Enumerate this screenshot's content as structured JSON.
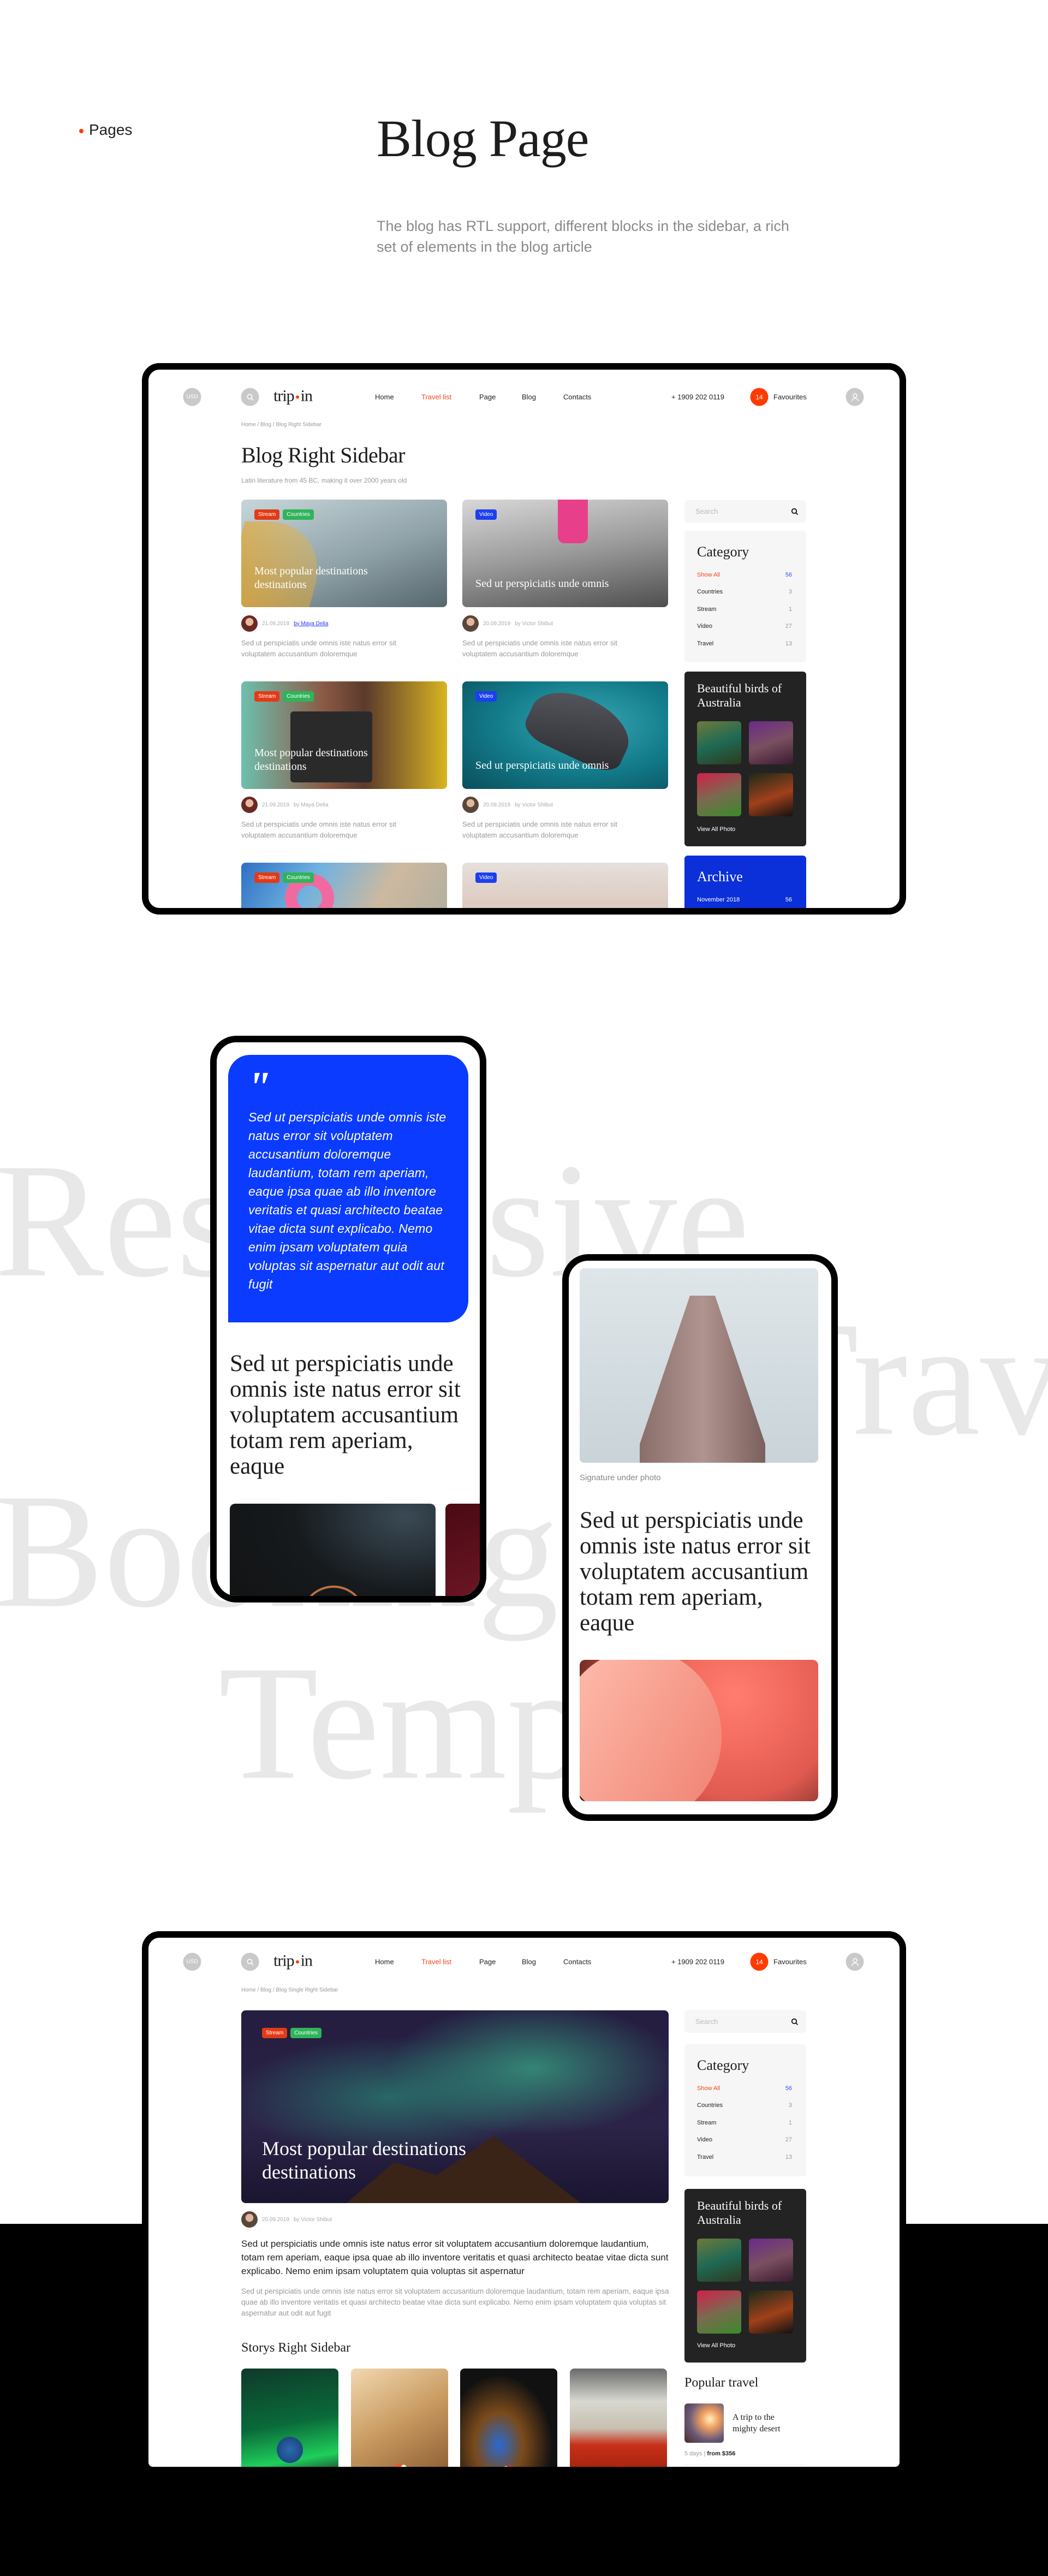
{
  "intro": {
    "section_label": "Pages",
    "title": "Blog Page",
    "subtitle": "The blog has RTL support, different blocks in the sidebar, a rich set of elements in the blog article"
  },
  "background_words": [
    "Responsive",
    "Travel",
    "Booking",
    "Template"
  ],
  "colors": {
    "accent": "#ff3b00",
    "blue": "#0a3bff",
    "tag_stream": "#e23a16",
    "tag_countries": "#2fb45a",
    "tag_video": "#1c3ff0",
    "dark": "#232323"
  },
  "header": {
    "currency": "USD",
    "logo": {
      "left": "trip",
      "right": "in"
    },
    "nav": [
      "Home",
      "Travel list",
      "Page",
      "Blog",
      "Contacts"
    ],
    "active_nav": "Travel list",
    "phone": "+ 1909 202 0119",
    "favourites_count": "14",
    "favourites_label": "Favourites",
    "icons": {
      "search": "search-icon",
      "user": "user-icon"
    }
  },
  "sidebar": {
    "search_placeholder": "Search",
    "category": {
      "title": "Category",
      "items": [
        {
          "label": "Show All",
          "count": "56"
        },
        {
          "label": "Countries",
          "count": "3"
        },
        {
          "label": "Stream",
          "count": "1"
        },
        {
          "label": "Video",
          "count": "27"
        },
        {
          "label": "Travel",
          "count": "13"
        }
      ]
    },
    "birds": {
      "title": "Beautiful birds of Australia",
      "link": "View All Photo"
    },
    "archive": {
      "title": "Archive",
      "month": "November 2018",
      "count": "56"
    },
    "popular": {
      "title": "Popular travel",
      "item_title": "A trip to the mighty desert",
      "days": "5 days",
      "price": "from $356"
    }
  },
  "blog_list": {
    "breadcrumb": "Home / Blog / Blog Right Sidebar",
    "title": "Blog Right Sidebar",
    "subtitle": "Latin literature from 45 BC, making it over 2000 years old",
    "tags": {
      "stream": "Stream",
      "countries": "Countries",
      "video": "Video"
    },
    "posts": [
      {
        "title": "Most popular destinations destinations",
        "date": "21.09.2019",
        "author": "by Maya Delia",
        "excerpt": "Sed ut perspiciatis unde omnis iste natus error sit voluptatem accusantium doloremque"
      },
      {
        "title": "Sed ut perspiciatis unde omnis",
        "date": "20.09.2019",
        "author": "by Victor Shibut",
        "excerpt": "Sed ut perspiciatis unde omnis iste natus error sit voluptatem accusantium doloremque"
      },
      {
        "title": "Most popular destinations destinations",
        "date": "21.09.2019",
        "author": "by Maya Delia",
        "excerpt": "Sed ut perspiciatis unde omnis iste natus error sit voluptatem accusantium doloremque"
      },
      {
        "title": "Sed ut perspiciatis unde omnis",
        "date": "20.09.2019",
        "author": "by Victor Shibut",
        "excerpt": "Sed ut perspiciatis unde omnis iste natus error sit voluptatem accusantium doloremque"
      }
    ]
  },
  "mobile": {
    "quote": "Sed ut perspiciatis unde omnis iste natus error sit voluptatem accusantium doloremque laudantium, totam rem aperiam, eaque ipsa quae ab illo inventore veritatis et quasi architecto beatae vitae dicta sunt explicabo. Nemo enim ipsam voluptatem quia voluptas sit aspernatur aut odit aut fugit",
    "heading": "Sed ut perspiciatis unde omnis iste natus error sit voluptatem accusantium totam rem aperiam, eaque",
    "caption": "Signature under photo"
  },
  "single": {
    "breadcrumb": "Home / Blog / Blog Single Right Sidebar",
    "hero_title": "Most popular destinations destinations",
    "date": "20.09.2019",
    "author": "by Victor Shibut",
    "lead": "Sed ut perspiciatis unde omnis iste natus error sit voluptatem accusantium doloremque laudantium, totam rem aperiam, eaque ipsa quae ab illo inventore veritatis et quasi architecto beatae vitae dicta sunt explicabo. Nemo enim ipsam voluptatem quia voluptas sit aspernatur",
    "body": "Sed ut perspiciatis unde omnis iste natus error sit voluptatem accusantium doloremque laudantium, totam rem aperiam, eaque ipsa quae ab illo inventore veritatis et quasi architecto beatae vitae dicta sunt explicabo. Nemo enim ipsam voluptatem quia voluptas sit aspernatur aut odit aut fugit",
    "stories_title": "Storys Right Sidebar"
  }
}
